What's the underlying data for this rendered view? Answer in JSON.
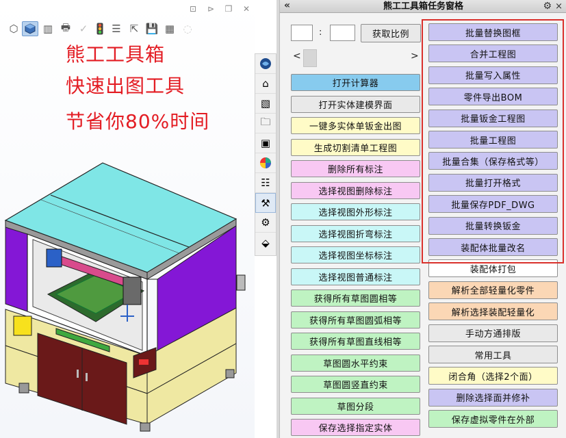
{
  "viewport": {
    "promo": {
      "line1": "熊工工具箱",
      "line2": "快速出图工具",
      "line3": "节省你80%时间"
    },
    "view_toolbar": [
      "view-orientation-icon",
      "display-style-icon",
      "section-view-icon",
      "print-icon",
      "check-icon",
      "traffic-light-icon",
      "properties-icon",
      "export-icon",
      "save-icon",
      "save-all-icon",
      "eye-hidden-icon"
    ],
    "window_controls": [
      "restore-icon",
      "next-icon",
      "maximize-icon",
      "close-icon"
    ]
  },
  "side_strip": [
    "solidworks-resources-icon",
    "home-icon",
    "design-library-icon",
    "file-explorer-icon",
    "view-palette-icon",
    "appearances-icon",
    "custom-properties-icon",
    "toolbox-icon",
    "settings-icon",
    "add-in-icon"
  ],
  "pane": {
    "title": "熊工工具箱任务窗格",
    "collapse_glyph": "«",
    "settings_glyph": "⚙",
    "close_glyph": "×",
    "ratio": {
      "left_value": "",
      "colon": ":",
      "right_value": "",
      "get_label": "获取比例"
    },
    "scroll": {
      "left": "<",
      "right": ">"
    },
    "left_buttons": [
      {
        "label": "打开计算器",
        "color": "blue"
      },
      {
        "label": "打开实体建模界面",
        "color": "gray"
      },
      {
        "label": "一键多实体单钣金出图",
        "color": "yellow"
      },
      {
        "label": "生成切割清单工程图",
        "color": "yellow"
      },
      {
        "label": "删除所有标注",
        "color": "pink"
      },
      {
        "label": "选择视图删除标注",
        "color": "pink"
      },
      {
        "label": "选择视图外形标注",
        "color": "cyan"
      },
      {
        "label": "选择视图折弯标注",
        "color": "cyan"
      },
      {
        "label": "选择视图坐标标注",
        "color": "cyan"
      },
      {
        "label": "选择视图普通标注",
        "color": "cyan"
      },
      {
        "label": "获得所有草图圆相等",
        "color": "green"
      },
      {
        "label": "获得所有草图圆弧相等",
        "color": "green"
      },
      {
        "label": "获得所有草图直线相等",
        "color": "green"
      },
      {
        "label": "草图圆水平约束",
        "color": "green"
      },
      {
        "label": "草图圆竖直约束",
        "color": "green"
      },
      {
        "label": "草图分段",
        "color": "green"
      },
      {
        "label": "保存选择指定实体",
        "color": "pink"
      }
    ],
    "right_buttons": [
      {
        "label": "批量替换图框",
        "color": "lav"
      },
      {
        "label": "合并工程图",
        "color": "lav"
      },
      {
        "label": "批量写入属性",
        "color": "lav"
      },
      {
        "label": "零件导出BOM",
        "color": "lav"
      },
      {
        "label": "批量钣金工程图",
        "color": "lav"
      },
      {
        "label": "批量工程图",
        "color": "lav"
      },
      {
        "label": "批量合集（保存格式等）",
        "color": "lav"
      },
      {
        "label": "批量打开格式",
        "color": "lav"
      },
      {
        "label": "批量保存PDF_DWG",
        "color": "lav"
      },
      {
        "label": "批量转换钣金",
        "color": "lav"
      },
      {
        "label": "装配体批量改名",
        "color": "lav"
      },
      {
        "label": "装配体打包",
        "color": "white"
      },
      {
        "label": "解析全部轻量化零件",
        "color": "orange"
      },
      {
        "label": "解析选择装配轻量化",
        "color": "orange"
      },
      {
        "label": "手动方通排版",
        "color": "gray"
      },
      {
        "label": "常用工具",
        "color": "gray"
      },
      {
        "label": "闭合角（选择2个面）",
        "color": "yellow"
      },
      {
        "label": "删除选择面并修补",
        "color": "lav"
      },
      {
        "label": "保存虚拟零件在外部",
        "color": "green"
      }
    ]
  }
}
